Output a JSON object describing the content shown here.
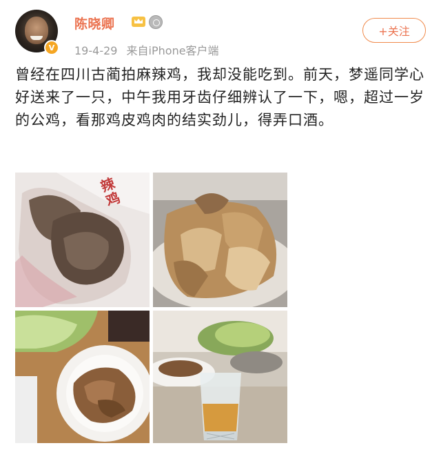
{
  "user": {
    "name": "陈晓卿",
    "verified_badge": "V",
    "icons": [
      "crown-icon",
      "medal-icon"
    ]
  },
  "meta": {
    "date": "19-4-29",
    "source": "来自iPhone客户端"
  },
  "follow_button": {
    "label": "+关注"
  },
  "post": {
    "text": "曾经在四川古蔺拍麻辣鸡，我却没能吃到。前天，梦遥同学心好送来了一只，中午我用牙齿仔细辨认了一下，嗯，超过一岁的公鸡，看那鸡皮鸡肉的结实劲儿，得弄口酒。"
  },
  "photos": {
    "p1": {
      "label_text": "辣鸡"
    }
  },
  "colors": {
    "accent": "#eb7350",
    "meta_gray": "#999999",
    "badge": "#f5a623"
  }
}
